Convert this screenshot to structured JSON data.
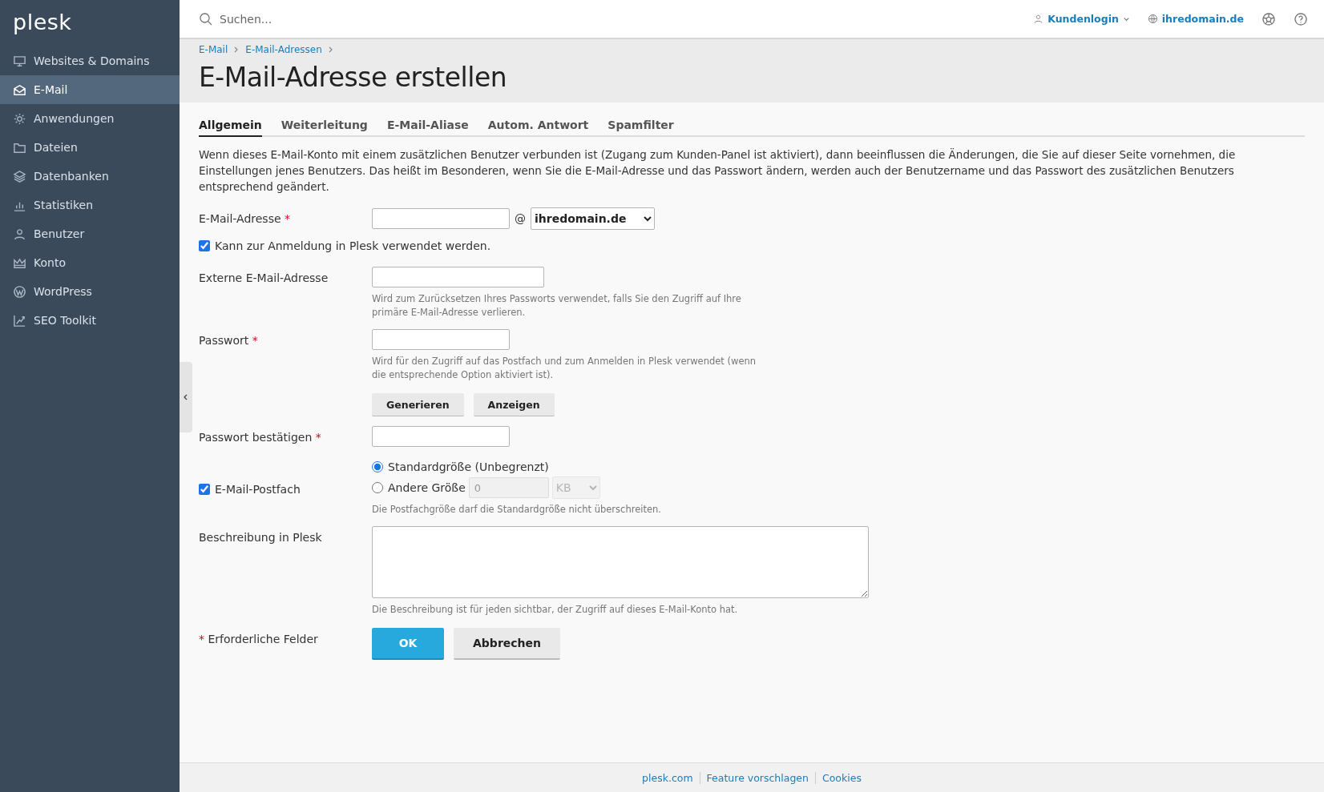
{
  "sidebar": {
    "logo": "plesk",
    "items": [
      {
        "label": "Websites & Domains",
        "selected": false
      },
      {
        "label": "E-Mail",
        "selected": true
      },
      {
        "label": "Anwendungen",
        "selected": false
      },
      {
        "label": "Dateien",
        "selected": false
      },
      {
        "label": "Datenbanken",
        "selected": false
      },
      {
        "label": "Statistiken",
        "selected": false
      },
      {
        "label": "Benutzer",
        "selected": false
      },
      {
        "label": "Konto",
        "selected": false
      },
      {
        "label": "WordPress",
        "selected": false
      },
      {
        "label": "SEO Toolkit",
        "selected": false
      }
    ]
  },
  "topbar": {
    "search": {
      "placeholder": "Suchen..."
    },
    "user": "Kundenlogin",
    "domain": "ihredomain.de"
  },
  "breadcrumbs": [
    "E-Mail",
    "E-Mail-Adressen"
  ],
  "title": "E-Mail-Adresse erstellen",
  "tabs": [
    {
      "label": "Allgemein",
      "selected": true
    },
    {
      "label": "Weiterleitung",
      "selected": false
    },
    {
      "label": "E-Mail-Aliase",
      "selected": false
    },
    {
      "label": "Autom. Antwort",
      "selected": false
    },
    {
      "label": "Spamfilter",
      "selected": false
    }
  ],
  "intro": "Wenn dieses E-Mail-Konto mit einem zusätzlichen Benutzer verbunden ist (Zugang zum Kunden-Panel ist aktiviert), dann beeinflussen die Änderungen, die Sie auf dieser Seite vornehmen, die Einstellungen jenes Benutzers. Das heißt im Besonderen, wenn Sie die E-Mail-Adresse und das Passwort ändern, werden auch der Benutzername und das Passwort des zusätzlichen Benutzers entsprechend geändert.",
  "email": {
    "label": "E-Mail-Adresse",
    "required_mark": "*",
    "at": "@",
    "domain": "ihredomain.de"
  },
  "login_checkbox": {
    "label": "Kann zur Anmeldung in Plesk verwendet werden.",
    "checked": true
  },
  "external": {
    "label": "Externe E-Mail-Adresse",
    "hint": "Wird zum Zurücksetzen Ihres Passworts verwendet, falls Sie den Zugriff auf Ihre primäre E-Mail-Adresse verlieren."
  },
  "password": {
    "label": "Passwort",
    "required_mark": "*",
    "hint": "Wird für den Zugriff auf das Postfach und zum Anmelden in Plesk verwendet (wenn die entsprechende Option aktiviert ist).",
    "buttons": [
      "Generieren",
      "Anzeigen"
    ]
  },
  "confirm": {
    "label": "Passwort bestätigen",
    "required_mark": "*"
  },
  "mailbox": {
    "label": "E-Mail-Postfach",
    "checked": true,
    "options": [
      {
        "label": "Standardgröße (Unbegrenzt)",
        "selected": true
      },
      {
        "label": "Andere Größe",
        "selected": false
      }
    ],
    "size_value": "0",
    "size_unit": "KB",
    "hint": "Die Postfachgröße darf die Standardgröße nicht überschreiten."
  },
  "description": {
    "label": "Beschreibung in Plesk",
    "hint": "Die Beschreibung ist für jeden sichtbar, der Zugriff auf dieses E-Mail-Konto hat."
  },
  "required_note": {
    "mark": "*",
    "text": "Erforderliche Felder"
  },
  "actions": [
    {
      "label": "OK",
      "kind": "primary"
    },
    {
      "label": "Abbrechen",
      "kind": "secondary"
    }
  ],
  "footer": [
    "plesk.com",
    "Feature vorschlagen",
    "Cookies"
  ]
}
